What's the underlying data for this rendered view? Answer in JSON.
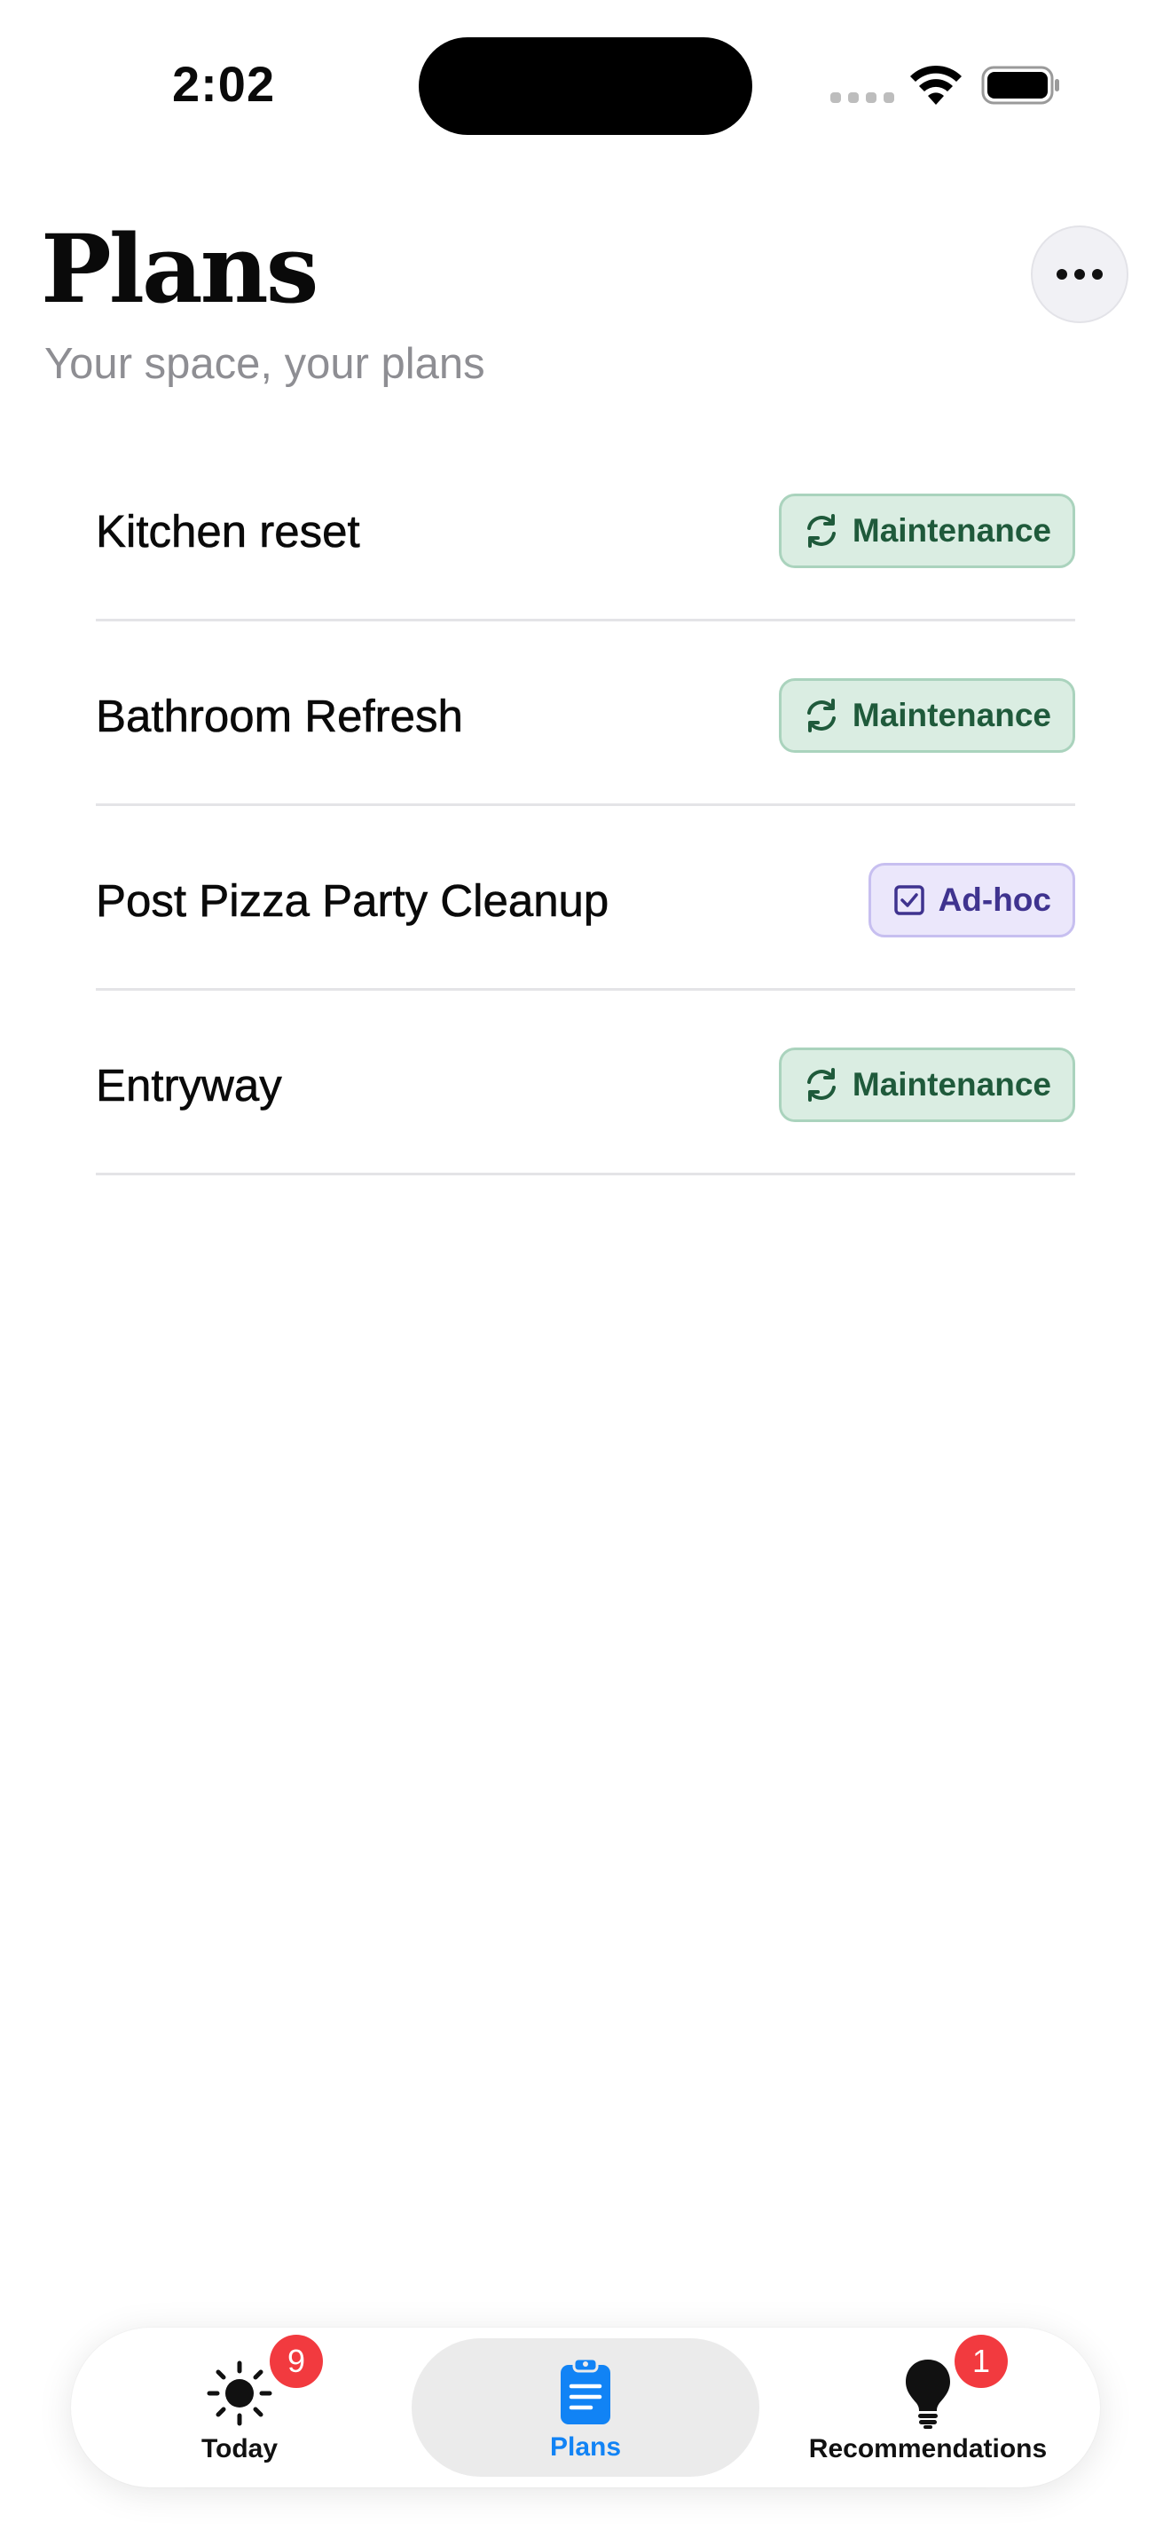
{
  "status_bar": {
    "time": "2:02"
  },
  "header": {
    "title": "Plans",
    "subtitle": "Your space, your plans",
    "more_icon": "ellipsis-icon"
  },
  "plans": [
    {
      "name": "Kitchen reset",
      "tag": "Maintenance",
      "tag_icon": "refresh-icon"
    },
    {
      "name": "Bathroom Refresh",
      "tag": "Maintenance",
      "tag_icon": "refresh-icon"
    },
    {
      "name": "Post Pizza Party Cleanup",
      "tag": "Ad-hoc",
      "tag_icon": "checkbox-icon"
    },
    {
      "name": "Entryway",
      "tag": "Maintenance",
      "tag_icon": "refresh-icon"
    }
  ],
  "tab_bar": {
    "tabs": [
      {
        "label": "Today",
        "icon": "sun-icon",
        "badge": "9",
        "selected": false
      },
      {
        "label": "Plans",
        "icon": "clipboard-icon",
        "badge": "",
        "selected": true
      },
      {
        "label": "Recommendations",
        "icon": "lightbulb-icon",
        "badge": "1",
        "selected": false
      }
    ]
  },
  "colors": {
    "accent": "#1183f5",
    "badge": "#f23a3f",
    "maintenance_bg": "#daede2",
    "maintenance_text": "#1f5a3b",
    "adhoc_bg": "#ebe7fb",
    "adhoc_text": "#3f338f",
    "subtitle": "#8e8e93"
  }
}
